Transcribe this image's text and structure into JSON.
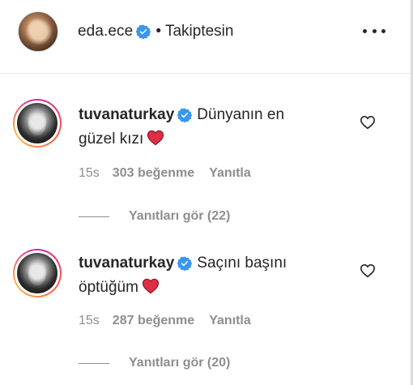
{
  "header": {
    "username": "eda.ece",
    "separator": "•",
    "follow_status": "Takiptesin"
  },
  "comments": [
    {
      "username": "tuvanaturkay",
      "text_line1": "Dünyanın en",
      "text_line2": "güzel kızı",
      "emoji": "red-heart-emoji",
      "time": "15s",
      "likes": "303 beğenme",
      "reply": "Yanıtla",
      "view_replies": "Yanıtları gör (22)"
    },
    {
      "username": "tuvanaturkay",
      "text_line1": "Saçını başını",
      "text_line2": "öptüğüm",
      "emoji": "red-heart-emoji",
      "time": "15s",
      "likes": "287 beğenme",
      "reply": "Yanıtla",
      "view_replies": "Yanıtları gör (20)"
    }
  ],
  "colors": {
    "text": "#262626",
    "muted": "#8e8e8e",
    "verified": "#3897f0",
    "heart": "#e0245e"
  }
}
